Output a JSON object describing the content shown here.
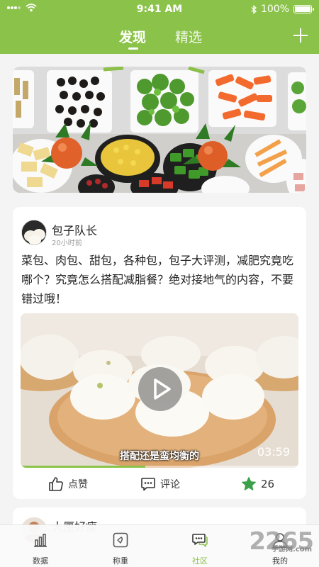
{
  "status": {
    "time": "9:41 AM",
    "battery": "100%"
  },
  "header": {
    "tabs": [
      {
        "label": "发现",
        "active": true
      },
      {
        "label": "精选",
        "active": false
      }
    ],
    "accent": "#8bc34a"
  },
  "post": {
    "username": "包子队长",
    "time": "20小时前",
    "text": "菜包、肉包、甜包，各种包，包子大评测，减肥究竟吃哪个？究竟怎么搭配减脂餐？绝对接地气的内容，不要错过哦！",
    "video": {
      "subtitle": "搭配还是蛮均衡的",
      "duration": "03:59",
      "progress_fraction": 0.45
    },
    "actions": {
      "like_label": "点赞",
      "comment_label": "评论",
      "favorite_count": "26"
    }
  },
  "next_post": {
    "username": "大厘好瘦"
  },
  "tabbar": {
    "items": [
      {
        "label": "数据",
        "icon": "bar-chart-icon"
      },
      {
        "label": "称重",
        "icon": "scale-icon"
      },
      {
        "label": "社区",
        "icon": "chat-icon",
        "active": true
      },
      {
        "label": "我的",
        "icon": "user-icon"
      }
    ]
  },
  "watermark": {
    "main": "2265",
    "sub": "手游网",
    "sub2": ".com"
  }
}
